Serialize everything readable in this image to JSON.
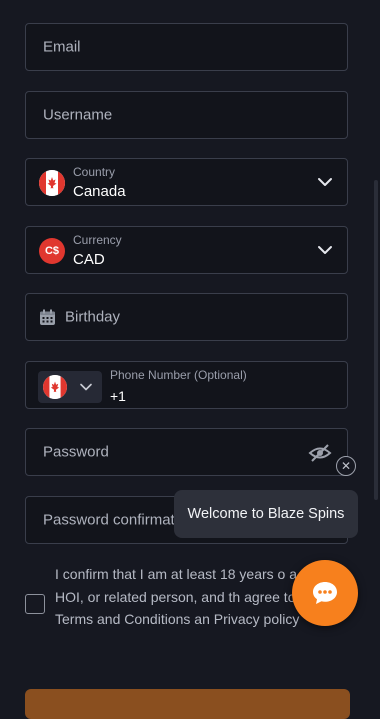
{
  "form": {
    "email_placeholder": "Email",
    "username_placeholder": "Username",
    "country": {
      "label": "Country",
      "value": "Canada"
    },
    "currency": {
      "label": "Currency",
      "value": "CAD",
      "badge": "C$"
    },
    "birthday_placeholder": "Birthday",
    "phone": {
      "label": "Phone Number (Optional)",
      "value": "+1"
    },
    "password_placeholder": "Password",
    "password_confirm_placeholder": "Password confirmat",
    "confirm_text": "I confirm that I am at least 18 years o a PEP, HOI, or related person, and th agree to the Terms and Conditions an Privacy policy"
  },
  "chat": {
    "tooltip": "Welcome to Blaze Spins"
  },
  "icons": {
    "flag": "canada-flag-icon",
    "currency": "currency-badge-icon",
    "calendar": "calendar-icon",
    "eye": "eye-off-icon",
    "chevron": "chevron-down-icon",
    "chat": "chat-bubble-icon",
    "close": "close-icon"
  },
  "colors": {
    "accent": "#f7801d",
    "field_border": "#3a3e4b",
    "background": "#161821",
    "currency_badge": "#e0372f"
  }
}
